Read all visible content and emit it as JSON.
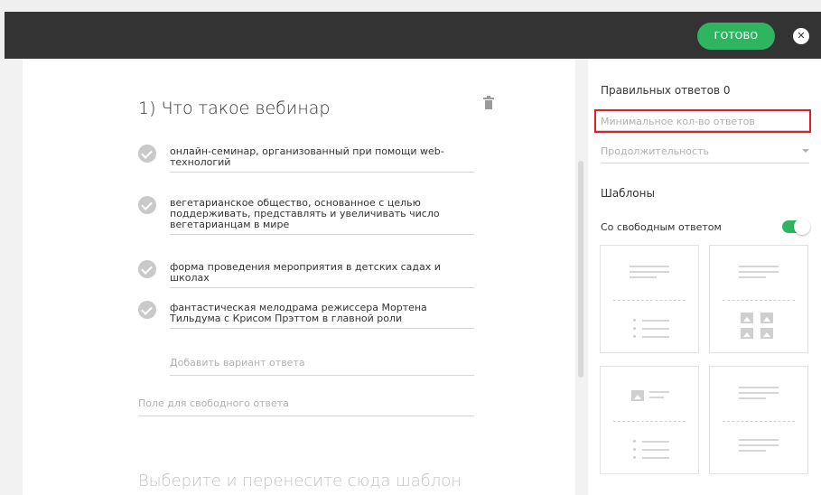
{
  "toolbar": {
    "done_label": "ГОТОВО",
    "close_symbol": "✕"
  },
  "question": {
    "title": "1) Что такое вебинар",
    "answers": [
      {
        "text": "онлайн-семинар, организованный при помощи web-технологий"
      },
      {
        "text": "вегетарианское общество, основанное с целью поддерживать, представлять и увеличивать число вегетарианцам в мире"
      },
      {
        "text": "форма проведения мероприятия в детских садах и школах"
      },
      {
        "text": "фантастическая мелодрама режиссера Мортена Тильдума с Крисом Прэттом в главной роли"
      }
    ],
    "add_variant_placeholder": "Добавить вариант ответа",
    "free_answer_placeholder": "Поле для свободного ответа",
    "drop_hint": "Выберите и перенесите сюда шаблон вашего вопроса"
  },
  "panel": {
    "correct_answers": "Правильных ответов 0",
    "min_answers_placeholder": "Минимальное кол-во ответов",
    "duration_placeholder": "Продолжительность",
    "templates_title": "Шаблоны",
    "free_answer_toggle_label": "Со свободным ответом",
    "free_answer_toggle_on": true
  },
  "colors": {
    "accent": "#2fb560",
    "topbar": "#333333",
    "highlight": "#e31e24"
  }
}
